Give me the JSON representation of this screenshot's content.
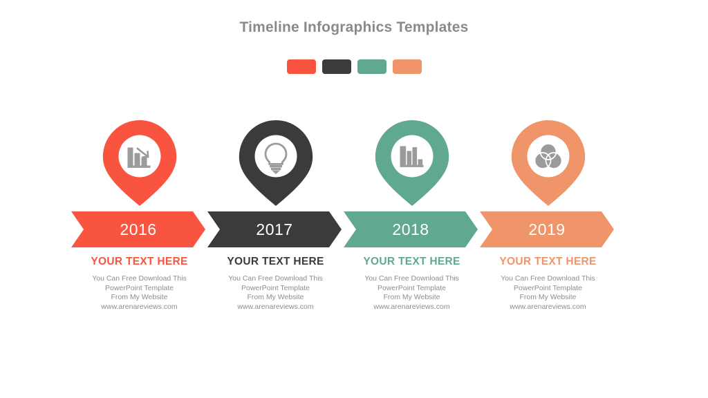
{
  "header": {
    "title": "Timeline Infographics Templates"
  },
  "palette": {
    "swatches": [
      {
        "name": "coral",
        "color": "#f9543f"
      },
      {
        "name": "dark",
        "color": "#3b3b3b"
      },
      {
        "name": "teal",
        "color": "#61a891"
      },
      {
        "name": "orange",
        "color": "#f0946a"
      }
    ]
  },
  "timeline": {
    "items": [
      {
        "year": "2016",
        "color": "#f9543f",
        "icon": "declining-bar-chart-icon",
        "heading": "YOUR TEXT HERE",
        "body": [
          "You Can Free Download This",
          "PowerPoint Template",
          "From My Website",
          "www.arenareviews.com"
        ]
      },
      {
        "year": "2017",
        "color": "#3b3b3b",
        "icon": "lightbulb-icon",
        "heading": "YOUR TEXT HERE",
        "body": [
          "You Can Free Download This",
          "PowerPoint Template",
          "From My Website",
          "www.arenareviews.com"
        ]
      },
      {
        "year": "2018",
        "color": "#61a891",
        "icon": "bar-chart-icon",
        "heading": "YOUR TEXT HERE",
        "body": [
          "You Can Free Download This",
          "PowerPoint Template",
          "From My Website",
          "www.arenareviews.com"
        ]
      },
      {
        "year": "2019",
        "color": "#f0946a",
        "icon": "venn-diagram-icon",
        "heading": "YOUR TEXT HERE",
        "body": [
          "You Can Free Download This",
          "PowerPoint Template",
          "From My Website",
          "www.arenareviews.com"
        ]
      }
    ]
  },
  "style": {
    "icon_glyph_color": "#9b9b9b",
    "body_text_color": "#8d8d8d",
    "title_color": "#8a8a8a",
    "year_text_color": "#ffffff"
  }
}
